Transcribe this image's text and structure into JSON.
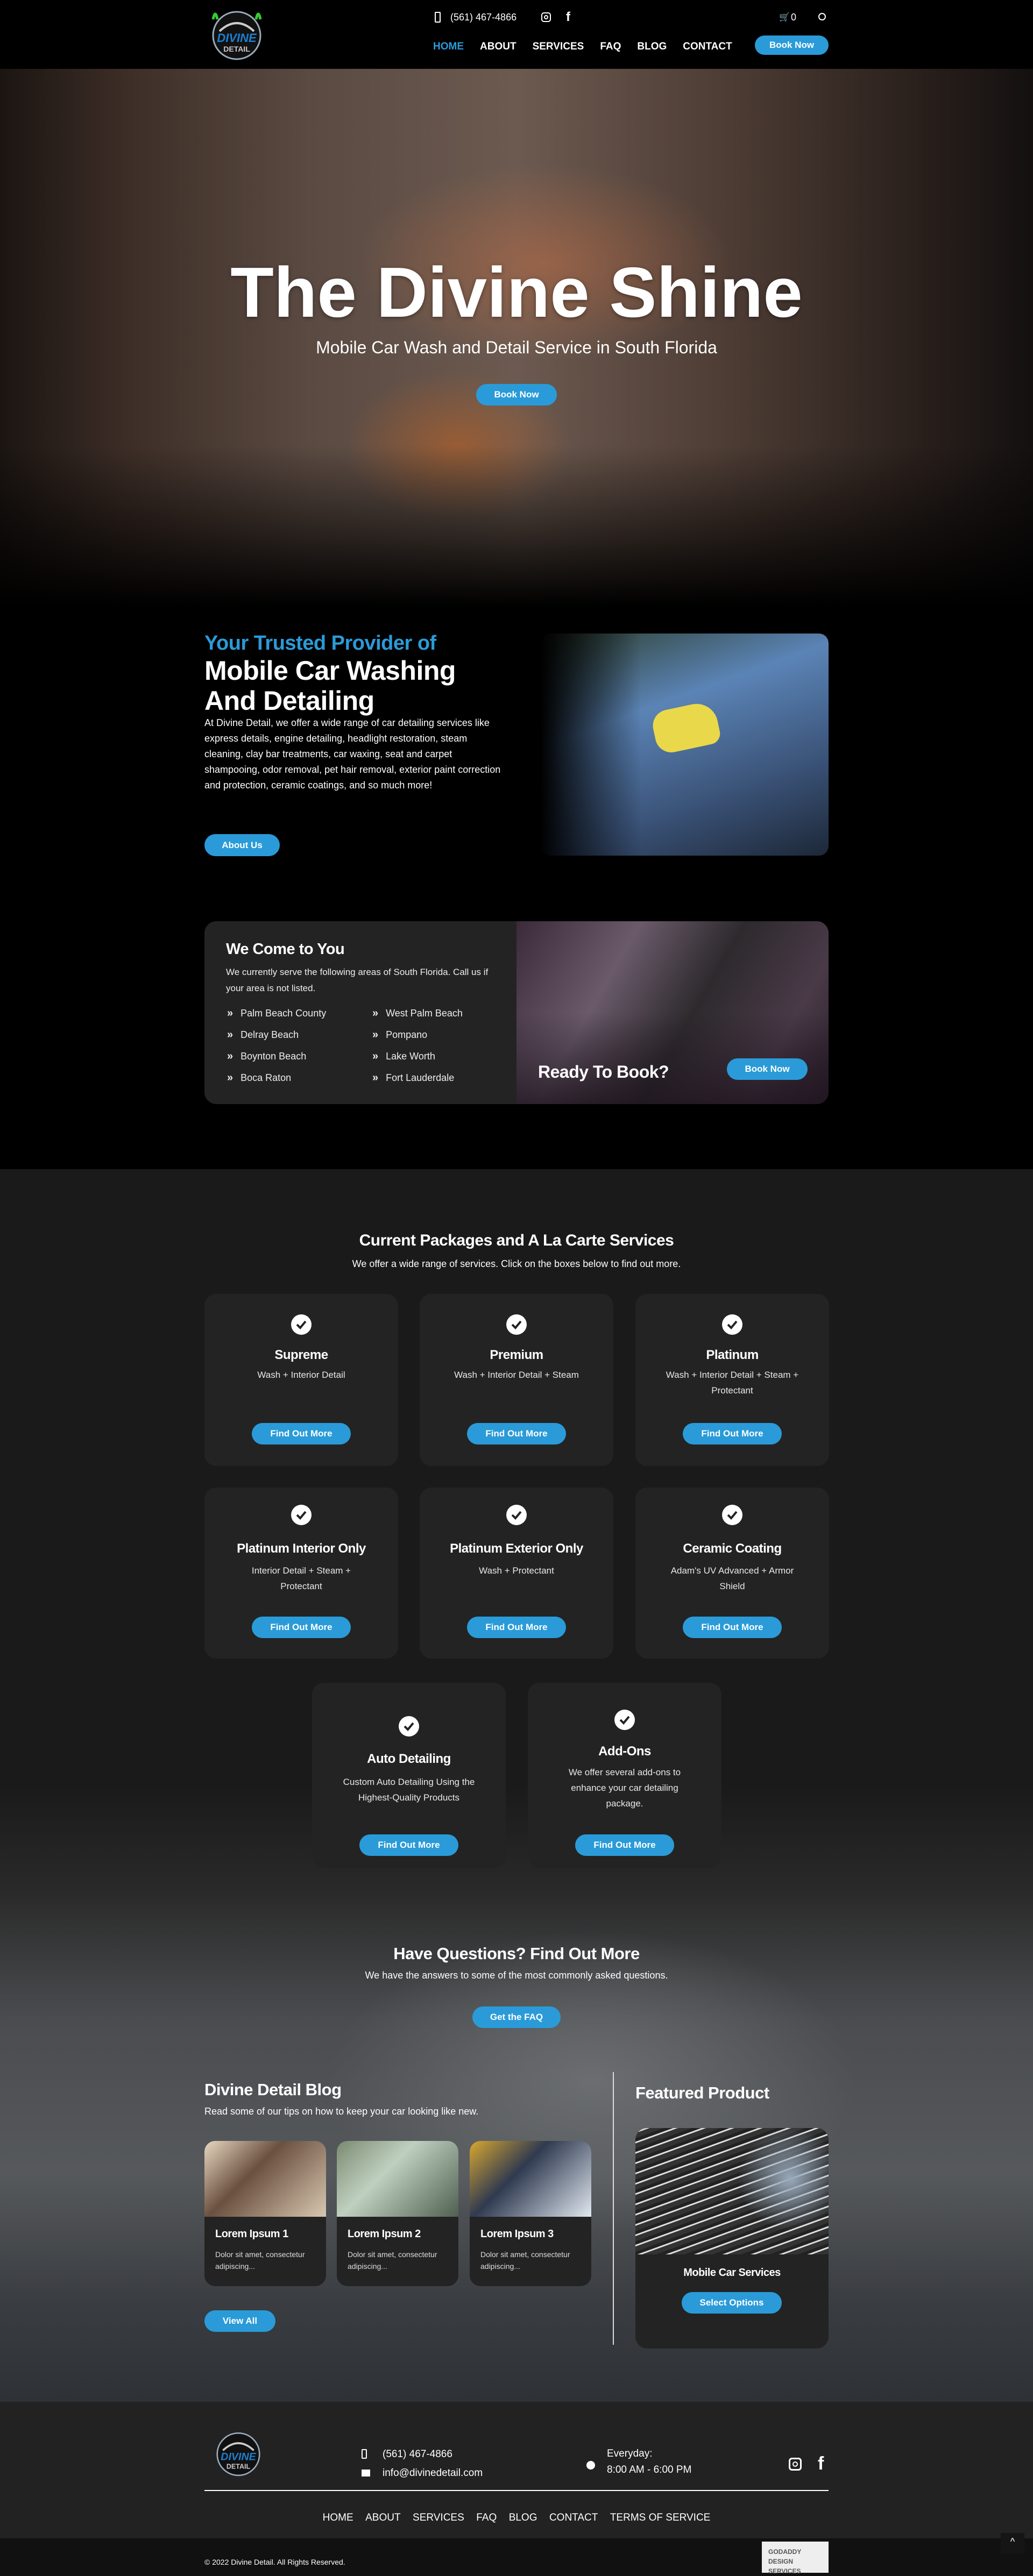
{
  "colors": {
    "accent": "#2a9bd8",
    "card": "#232323",
    "section": "#1a1a1a"
  },
  "header": {
    "logo_text": "DIVINE DETAIL",
    "phone": "(561) 467-4866",
    "cart_count": "0",
    "nav": [
      "HOME",
      "ABOUT",
      "SERVICES",
      "FAQ",
      "BLOG",
      "CONTACT"
    ],
    "active": "HOME",
    "book": "Book Now",
    "icons": [
      "phone-icon",
      "instagram-icon",
      "facebook-icon",
      "cart-icon",
      "search-icon"
    ]
  },
  "hero": {
    "title": "The Divine Shine",
    "subtitle": "Mobile Car Wash and Detail Service in South Florida",
    "button": "Book Now"
  },
  "about": {
    "kicker": "Your Trusted Provider of",
    "title_1": "Mobile Car Washing",
    "title_2": "And Detailing",
    "body": "At Divine Detail, we offer a wide range of car detailing services like express details, engine detailing, headlight restoration, steam cleaning, clay bar treatments, car waxing, seat and carpet shampooing, odor removal, pet hair removal, exterior paint correction and protection, ceramic coatings, and so much more!",
    "button": "About Us"
  },
  "areas": {
    "title": "We Come to You",
    "body": "We currently serve the following areas of South Florida. Call us if your area is not listed.",
    "list": [
      "Palm Beach County",
      "West Palm Beach",
      "Delray Beach",
      "Pompano",
      "Boynton Beach",
      "Lake Worth",
      "Boca Raton",
      "Fort Lauderdale"
    ],
    "cta": "Ready To Book?",
    "button": "Book Now"
  },
  "packages": {
    "title": "Current Packages and A La Carte Services",
    "subtitle": "We offer a wide range of services. Click on the boxes below to find out more.",
    "items": [
      {
        "name": "Supreme",
        "desc": "Wash + Interior Detail",
        "button": "Find Out More"
      },
      {
        "name": "Premium",
        "desc": "Wash + Interior Detail + Steam",
        "button": "Find Out More"
      },
      {
        "name": "Platinum",
        "desc": "Wash + Interior Detail + Steam + Protectant",
        "button": "Find Out More"
      },
      {
        "name": "Platinum Interior Only",
        "desc": "Interior Detail + Steam + Protectant",
        "button": "Find Out More"
      },
      {
        "name": "Platinum Exterior Only",
        "desc": "Wash + Protectant",
        "button": "Find Out More"
      },
      {
        "name": "Ceramic Coating",
        "desc": "Adam's UV Advanced + Armor Shield",
        "button": "Find Out More"
      },
      {
        "name": "Auto Detailing",
        "desc": "Custom Auto Detailing Using the Highest-Quality Products",
        "button": "Find Out More"
      },
      {
        "name": "Add-Ons",
        "desc": "We offer several add-ons to enhance your car detailing package.",
        "button": "Find Out More"
      }
    ]
  },
  "faq": {
    "title": "Have Questions? Find Out More",
    "subtitle": "We have the answers to some of the most commonly asked questions.",
    "button": "Get the FAQ"
  },
  "blog": {
    "title": "Divine Detail Blog",
    "subtitle": "Read some of our tips on how to keep your car looking like new.",
    "posts": [
      {
        "title": "Lorem Ipsum 1",
        "excerpt": "Dolor sit amet, consectetur adipiscing..."
      },
      {
        "title": "Lorem Ipsum 2",
        "excerpt": "Dolor sit amet, consectetur adipiscing..."
      },
      {
        "title": "Lorem Ipsum 3",
        "excerpt": "Dolor sit amet, consectetur adipiscing..."
      }
    ],
    "button": "View All"
  },
  "featured": {
    "title": "Featured Product",
    "product": "Mobile Car Services",
    "button": "Select Options"
  },
  "footer": {
    "phone": "(561) 467-4866",
    "email": "info@divinedetail.com",
    "hours_label": "Everyday:",
    "hours": "8:00 AM - 6:00 PM",
    "nav": [
      "HOME",
      "ABOUT",
      "SERVICES",
      "FAQ",
      "BLOG",
      "CONTACT",
      "TERMS OF SERVICE"
    ],
    "copyright": "© 2022 Divine Detail. All Rights Reserved.",
    "badge_1": "GODADDY",
    "badge_2": "DESIGN SERVICES",
    "scroll_top": "^"
  }
}
